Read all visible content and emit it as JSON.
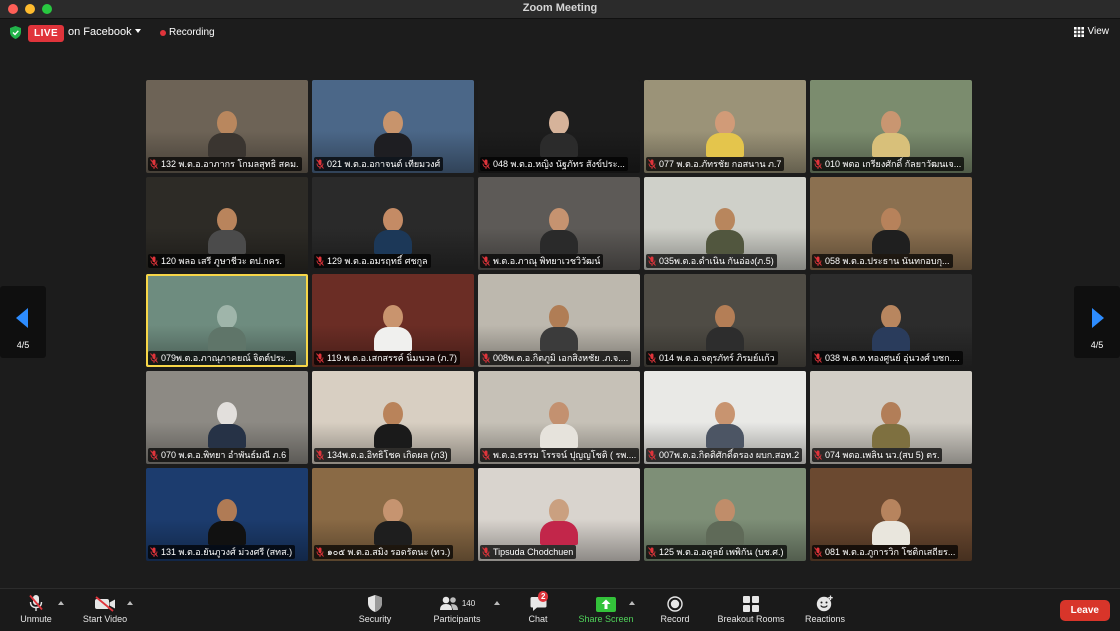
{
  "window": {
    "title": "Zoom Meeting"
  },
  "topbar": {
    "live_badge": "LIVE",
    "live_target": "on Facebook",
    "recording_label": "Recording",
    "view_label": "View"
  },
  "pager": {
    "left_label": "4/5",
    "right_label": "4/5"
  },
  "participants": [
    {
      "name": "132 พ.ต.อ.อาภากร โกมลสุทธิ สคม.",
      "bg": "#6d6356",
      "skin": "#b9875e",
      "shirt": "#3a3530"
    },
    {
      "name": "021 พ.ต.อ.อกาจนต์ เทียมวงศ์",
      "bg": "#4b6788",
      "skin": "#c8946c",
      "shirt": "#1e1e22"
    },
    {
      "name": "048 พ.ต.อ.หญิง นัฐภัทร สังข์ประ...",
      "bg": "#1d1d1d",
      "skin": "#d6b39a",
      "shirt": "#2b2b2b"
    },
    {
      "name": "077 พ.ต.อ.ภัทรชัย กอสนาน ภ.7",
      "bg": "#9b9378",
      "skin": "#d19b78",
      "shirt": "#e4c54c"
    },
    {
      "name": "010 พตอ เกรียงศักดิ์ กัลยาวัฒนเจ...",
      "bg": "#7b8c6e",
      "skin": "#c99671",
      "shirt": "#d8c07a"
    },
    {
      "name": "120 พลอ เสรี ภูษาชีวะ ตป.กคร.",
      "bg": "#2d2b26",
      "skin": "#b9845c",
      "shirt": "#4b4b4b"
    },
    {
      "name": "129 พ.ต.อ.อมรฤทธิ์ ศชกูล",
      "bg": "#2a2a2a",
      "skin": "#c48b65",
      "shirt": "#1c3858"
    },
    {
      "name": "พ.ต.อ.ภาณุ พิทยาเวชวิวัฒน์",
      "bg": "#5d5a57",
      "skin": "#c69370",
      "shirt": "#2a2a2a"
    },
    {
      "name": "035พ.ต.อ.ดำเนิน กันอ่อง(ภ.5)",
      "bg": "#cfd0c9",
      "skin": "#b8865d",
      "shirt": "#51563e"
    },
    {
      "name": "058 พ.ต.อ.ประธาน นันทกอบกุ...",
      "bg": "#8b7050",
      "skin": "#b7825b",
      "shirt": "#1f1f1f"
    },
    {
      "name": "079พ.ต.อ.ภาณุภาคยณ์ จิตต์ประ...",
      "bg": "#6e8c7f",
      "skin": "#9fb5aa",
      "shirt": "#5f7569"
    },
    {
      "name": "119.พ.ต.อ.เสกสรรค์ นิ่มนวล (ภ.7)",
      "bg": "#6b2d25",
      "skin": "#c9946e",
      "shirt": "#f0f0ee"
    },
    {
      "name": "008พ.ต.อ.กิตภูมิ เอกสิงหชัย .ภ.จ....",
      "bg": "#bdb8ae",
      "skin": "#b07d55",
      "shirt": "#3b3b3b"
    },
    {
      "name": "014 พ.ต.อ.จตุรภัทร์ ภิรมย์แก้ว",
      "bg": "#4f4c45",
      "skin": "#b47e56",
      "shirt": "#2d2d2d"
    },
    {
      "name": "038 พ.ต.ท.ทองศูนย์ อุ่นวงศ์ บชก....",
      "bg": "#2c2c2c",
      "skin": "#b8865f",
      "shirt": "#2a3c5c"
    },
    {
      "name": "070 พ.ต.อ.พิทยา อำพันธ์มณี ภ.6",
      "bg": "#8d8a84",
      "skin": "#e2dfdc",
      "shirt": "#263246"
    },
    {
      "name": "134พ.ต.อ.อิทธิโชค เกิดผล (ภ3)",
      "bg": "#d8cfc2",
      "skin": "#b9835a",
      "shirt": "#1a1a1a"
    },
    {
      "name": "พ.ต.อ.ธรรม โรรจน์ ปุญญโชติ ( รพ....",
      "bg": "#c6c1b7",
      "skin": "#c39170",
      "shirt": "#e6e3dc"
    },
    {
      "name": "007พ.ต.อ.กิตติศักดิ์ตรอง ผบก.สอท.2",
      "bg": "#e9e9e6",
      "skin": "#c89470",
      "shirt": "#4c5564"
    },
    {
      "name": "074 พตอ.เพลิน นว.(สบ 5) ตร.",
      "bg": "#d2cec6",
      "skin": "#b27e58",
      "shirt": "#7e7040"
    },
    {
      "name": "131 พ.ต.อ.ยันภูวงศ์ ม่วงศรี (สทส.)",
      "bg": "#1c3c6e",
      "skin": "#b07b55",
      "shirt": "#111111"
    },
    {
      "name": "๑๐๕ พ.ต.อ.สมิง รอดรัตนะ (ทว.)",
      "bg": "#8a6a45",
      "skin": "#c69470",
      "shirt": "#1e1e1e"
    },
    {
      "name": "Tipsuda Chodchuen",
      "bg": "#d9d4ce",
      "skin": "#caa080",
      "shirt": "#c2264a"
    },
    {
      "name": "125 พ.ต.อ.อคูลย์ เพพิกัน (บช.ศ.)",
      "bg": "#7e8f77",
      "skin": "#c08d6a",
      "shirt": "#5f6a58"
    },
    {
      "name": "081 พ.ต.อ.ภูการวิก โชติกเสถียร...",
      "bg": "#6b4930",
      "skin": "#b7845e",
      "shirt": "#e9e6dd"
    }
  ],
  "toolbar": {
    "unmute": "Unmute",
    "start_video": "Start Video",
    "security": "Security",
    "participants": "Participants",
    "participants_count": "140",
    "chat": "Chat",
    "chat_badge": "2",
    "share_screen": "Share Screen",
    "record": "Record",
    "breakout_rooms": "Breakout Rooms",
    "reactions": "Reactions",
    "leave": "Leave"
  },
  "colors": {
    "accent_green": "#33c23a",
    "leave_red": "#d8352a",
    "active_speaker": "#f7d648",
    "live_red": "#e0343b"
  }
}
